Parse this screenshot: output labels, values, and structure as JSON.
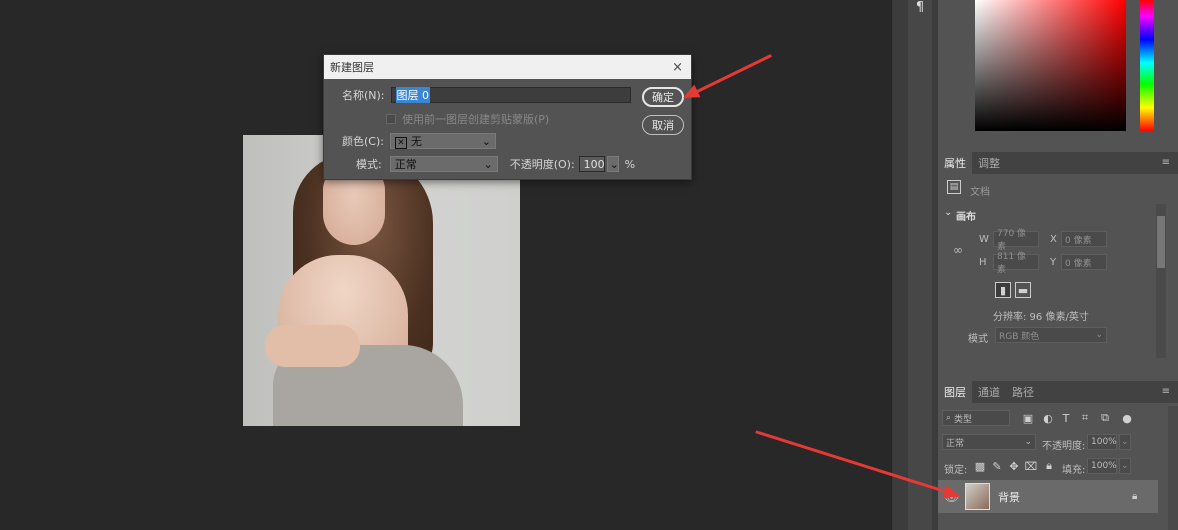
{
  "dialog": {
    "title": "新建图层",
    "name_label": "名称(N):",
    "name_value": "图层 0",
    "clip_label": "使用前一图层创建剪贴蒙版(P)",
    "color_label": "颜色(C):",
    "color_value": "无",
    "mode_label": "模式:",
    "mode_value": "正常",
    "opacity_label": "不透明度(O):",
    "opacity_value": "100",
    "opacity_unit": "%",
    "ok": "确定",
    "cancel": "取消",
    "close": "×"
  },
  "properties": {
    "tabs": [
      "属性",
      "调整"
    ],
    "doc_label": "文档",
    "section": "画布",
    "w_label": "W",
    "w_value": "770 像素",
    "h_label": "H",
    "h_value": "811 像素",
    "x_label": "X",
    "x_value": "0 像素",
    "y_label": "Y",
    "y_value": "0 像素",
    "resolution": "分辨率: 96 像素/英寸",
    "mode_label": "模式",
    "mode_value": "RGB 颜色"
  },
  "layers": {
    "tabs": [
      "图层",
      "通道",
      "路径"
    ],
    "filter_label": "类型",
    "blend_value": "正常",
    "opacity_label": "不透明度:",
    "opacity_value": "100%",
    "lock_label": "锁定:",
    "fill_label": "填充:",
    "fill_value": "100%",
    "layer_name": "背景"
  },
  "dock": {
    "paragraph_glyph": "¶"
  },
  "colors": {
    "annotation_arrow": "#e53935",
    "selection": "#3a86d6"
  }
}
